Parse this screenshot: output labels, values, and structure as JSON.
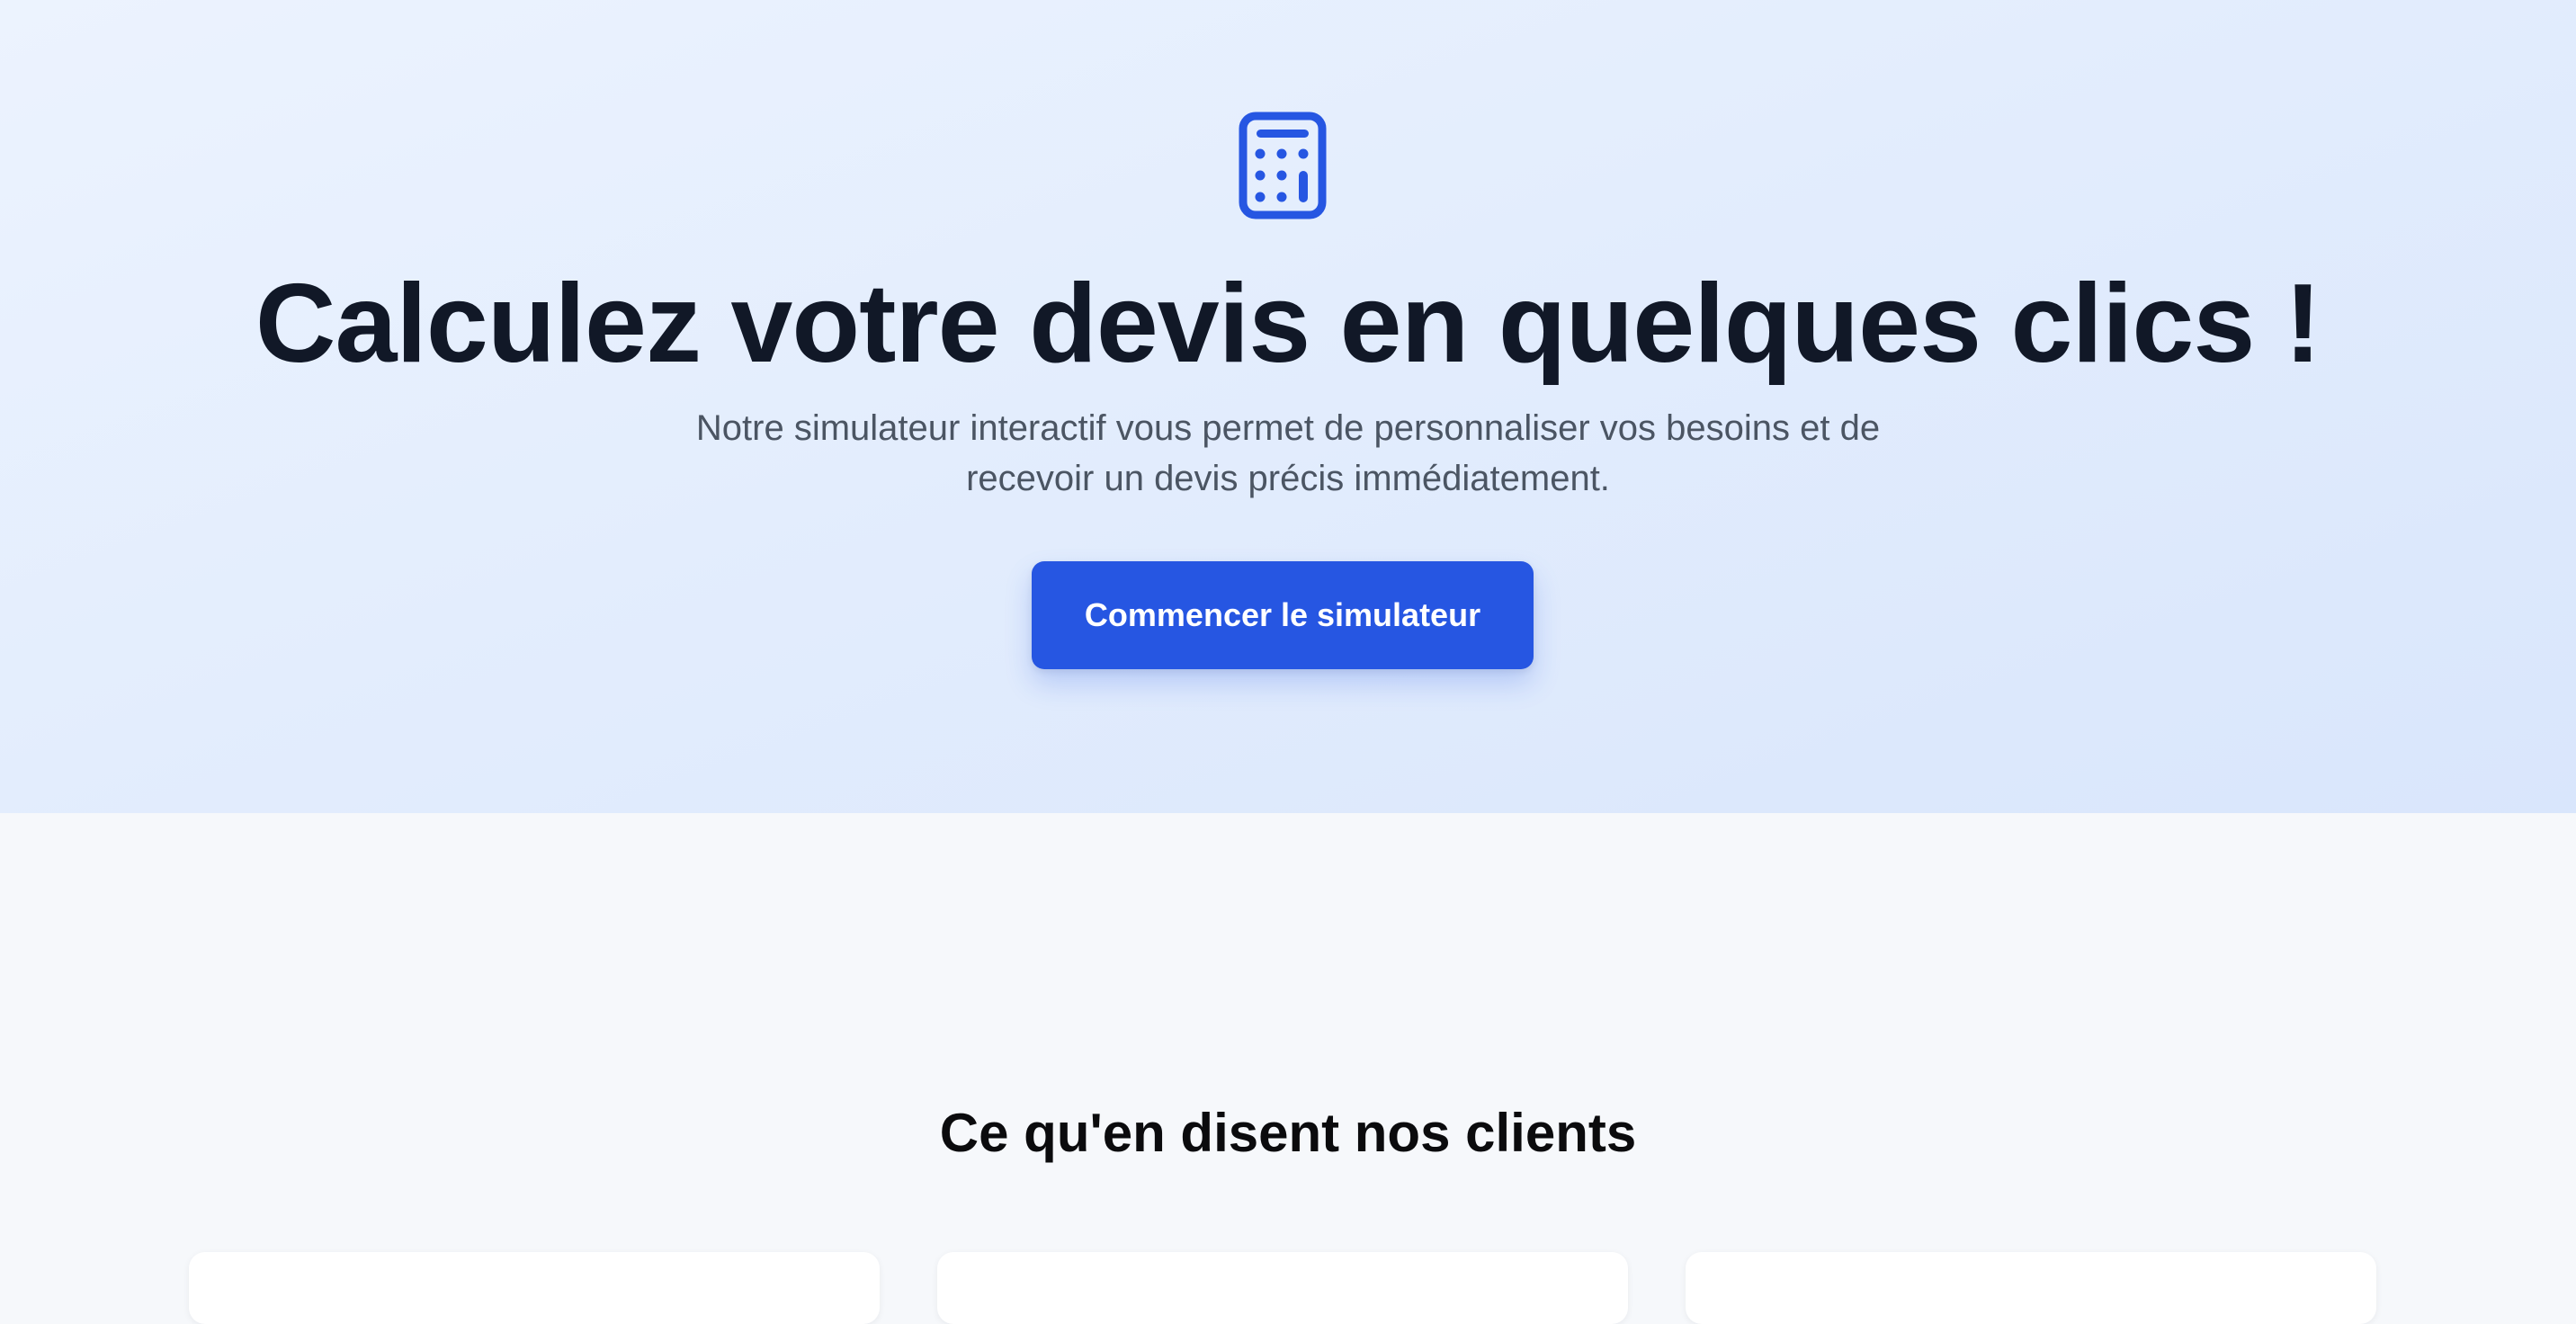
{
  "hero": {
    "icon": "calculator-icon",
    "title": "Calculez votre devis en quelques clics !",
    "subtitle": "Notre simulateur interactif vous permet de personnaliser vos besoins et de recevoir un devis précis immédiatement.",
    "cta_label": "Commencer le simulateur"
  },
  "testimonials": {
    "title": "Ce qu'en disent nos clients"
  },
  "colors": {
    "accent": "#2656e2",
    "heading": "#111827",
    "body_text": "#4b5563",
    "hero_background": "#e3edfd",
    "page_background": "#f6f8fb"
  }
}
